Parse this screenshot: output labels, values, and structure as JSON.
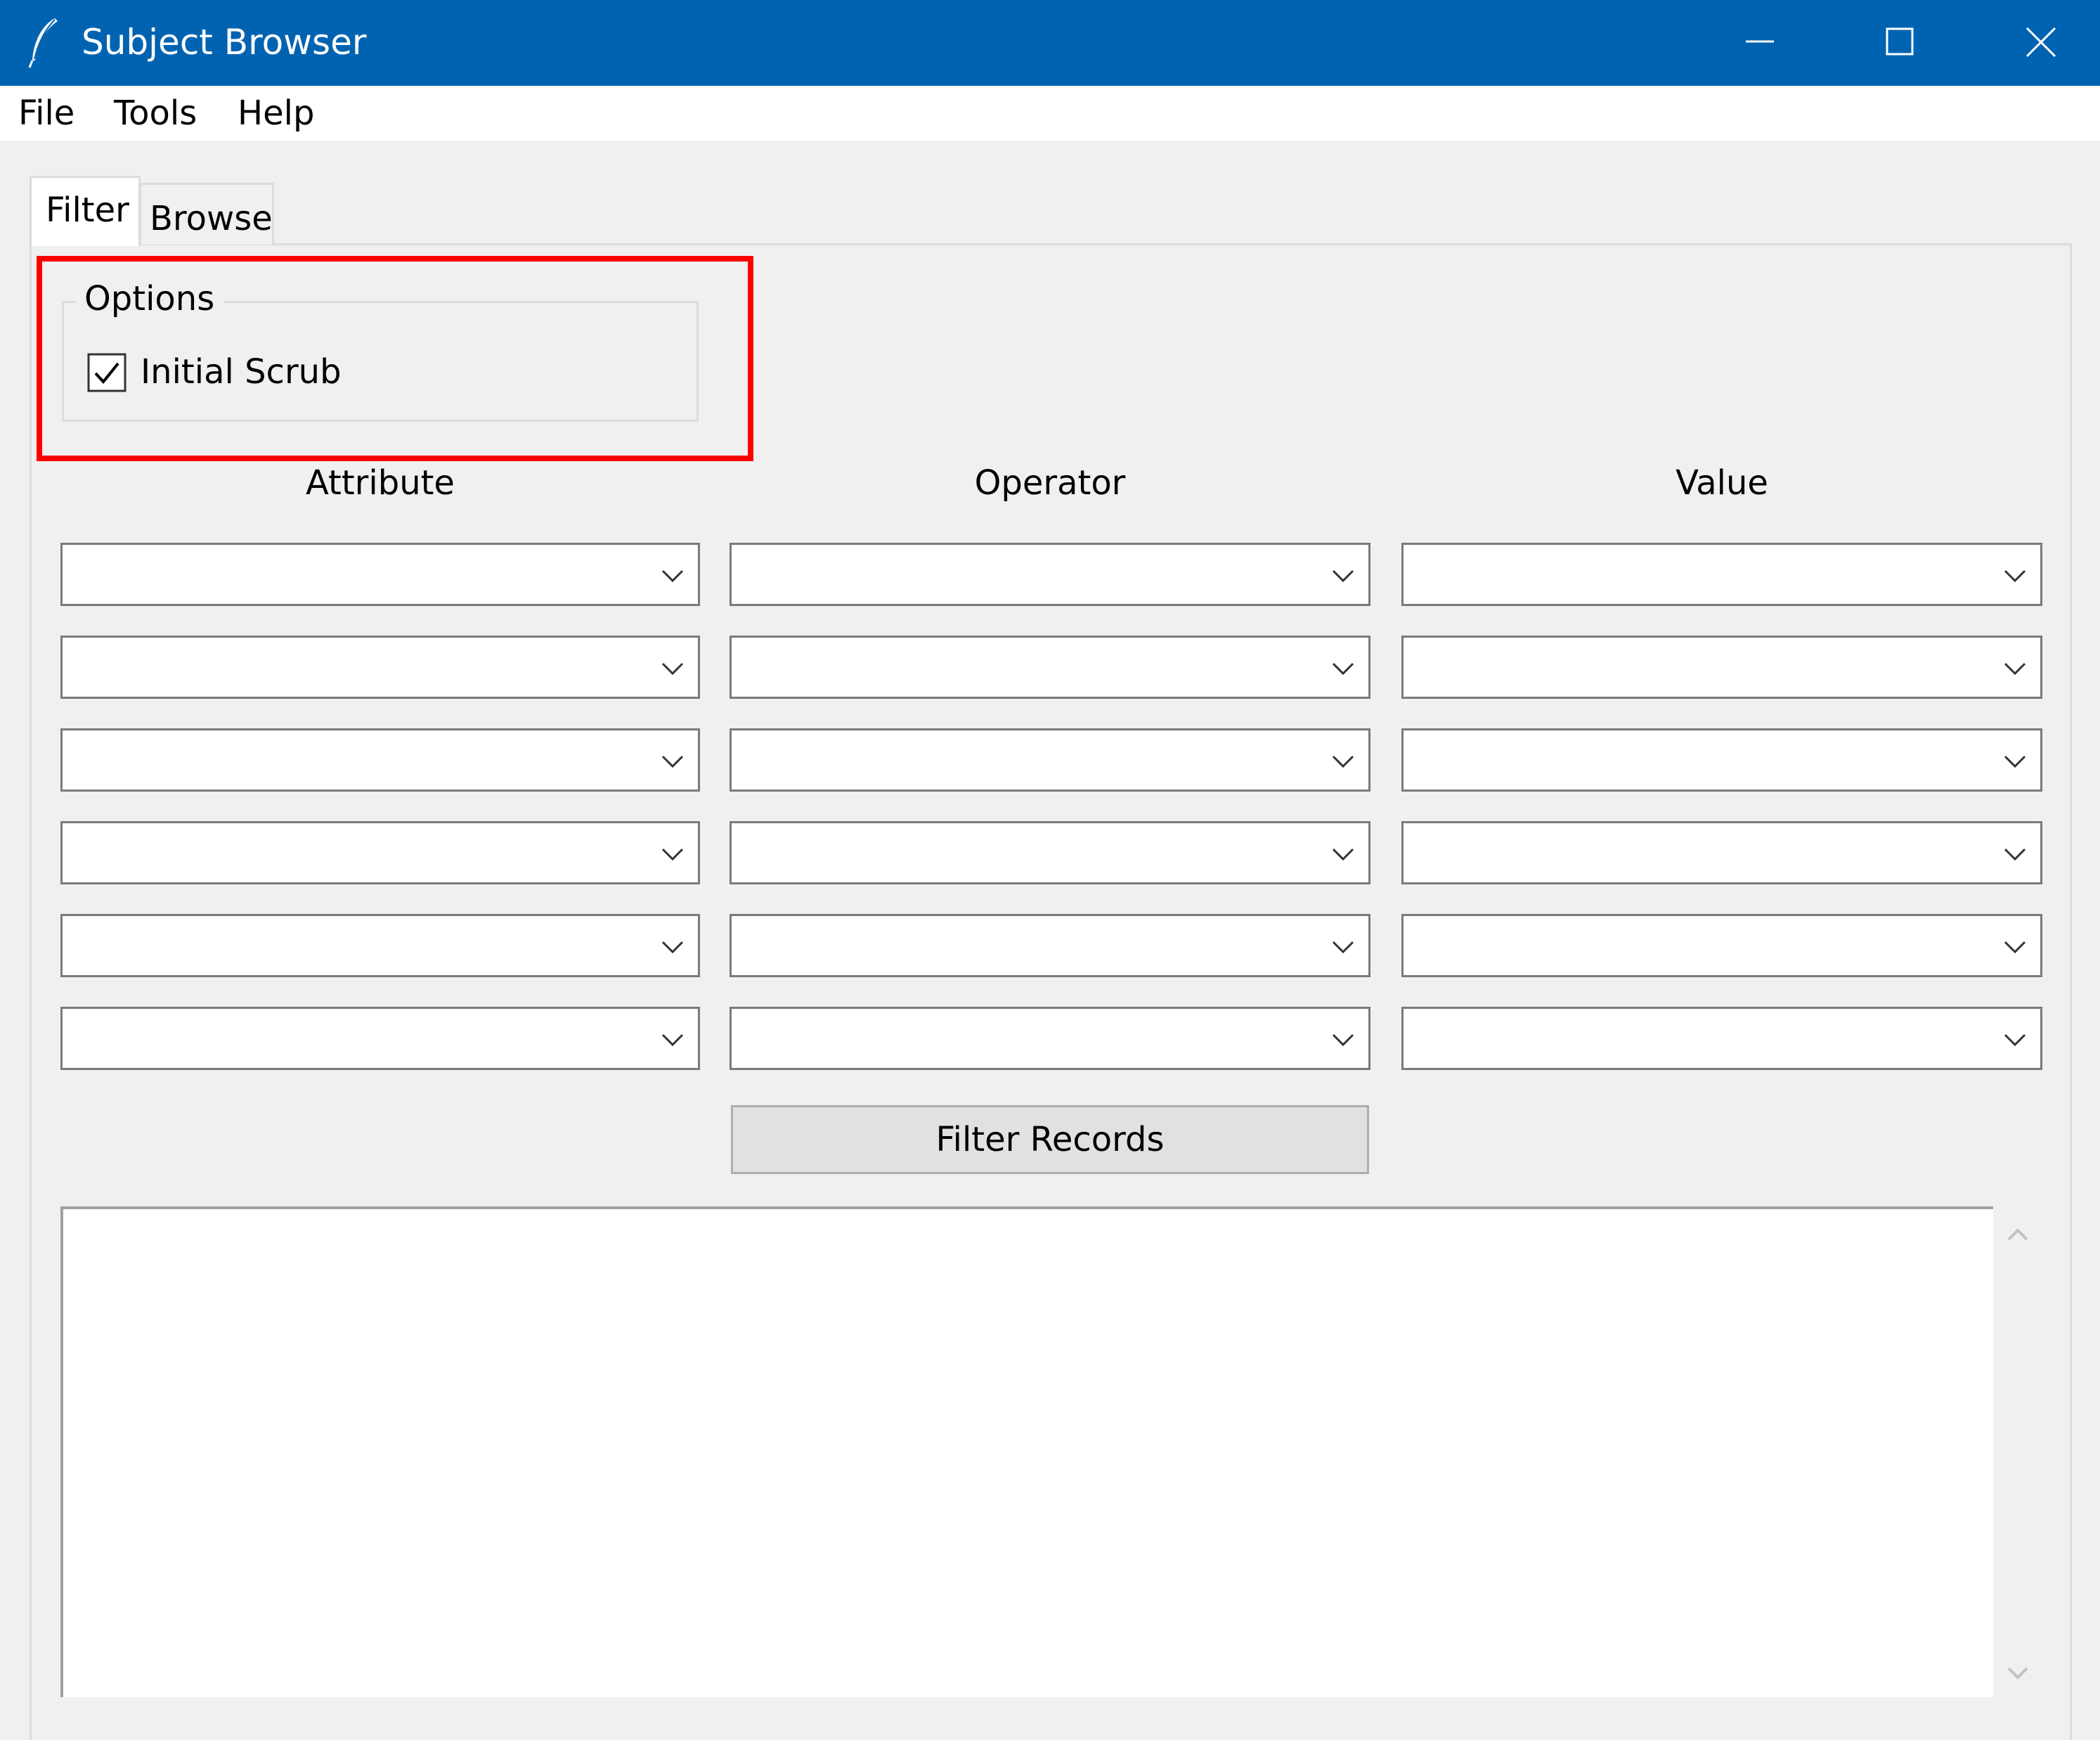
{
  "window": {
    "title": "Subject Browser",
    "title_bar_color": "#0063b1",
    "app_icon": "feather-icon",
    "controls": [
      "minimize-icon",
      "maximize-icon",
      "close-icon"
    ]
  },
  "menu": {
    "file": "File",
    "tools": "Tools",
    "help": "Help"
  },
  "tabs": {
    "filter": "Filter",
    "browse": "Browse",
    "active": "Filter"
  },
  "options": {
    "group_label": "Options",
    "initial_scrub_label": "Initial Scrub",
    "initial_scrub_checked": true,
    "highlight_color": "#ff0000"
  },
  "columns": {
    "attribute": "Attribute",
    "operator": "Operator",
    "value": "Value"
  },
  "filter_rows": [
    {
      "attribute": "",
      "operator": "",
      "value": ""
    },
    {
      "attribute": "",
      "operator": "",
      "value": ""
    },
    {
      "attribute": "",
      "operator": "",
      "value": ""
    },
    {
      "attribute": "",
      "operator": "",
      "value": ""
    },
    {
      "attribute": "",
      "operator": "",
      "value": ""
    },
    {
      "attribute": "",
      "operator": "",
      "value": ""
    }
  ],
  "filter_button": "Filter Records",
  "results": {
    "text": ""
  }
}
